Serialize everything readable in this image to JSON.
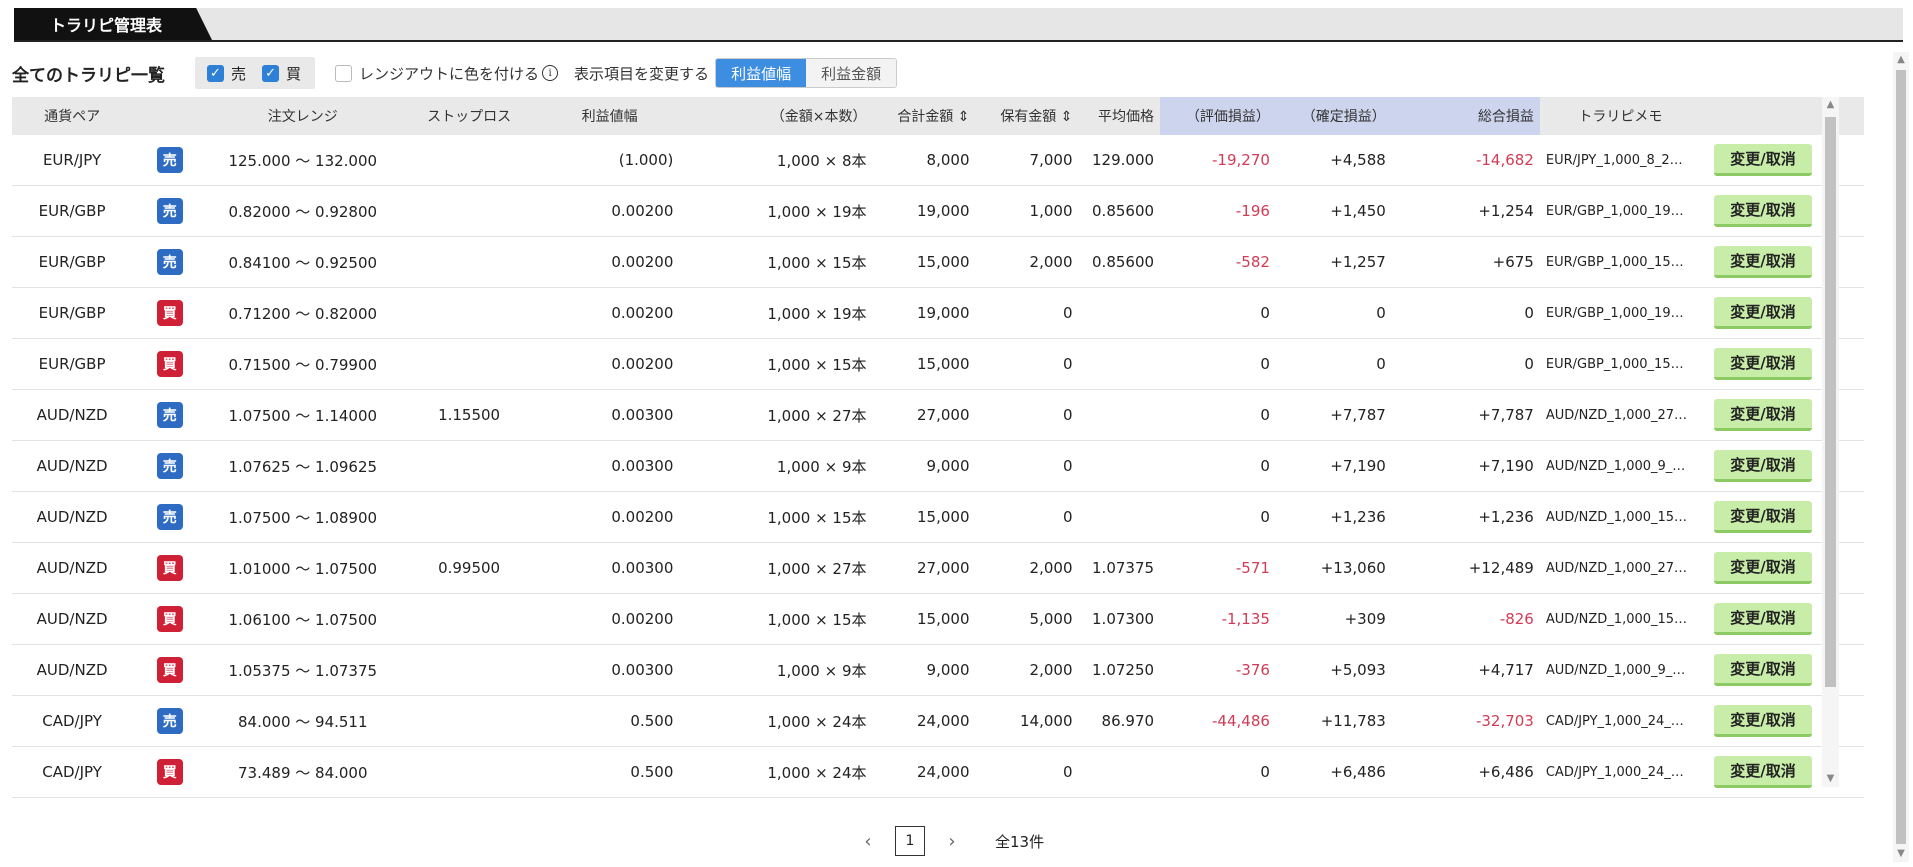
{
  "tabs": {
    "active_label": "トラリピ管理表"
  },
  "toolbar": {
    "title": "全てのトラリピ一覧",
    "sell_label": "売",
    "buy_label": "買",
    "color_label": "レンジアウトに色を付ける",
    "info_glyph": "i",
    "change_label": "表示項目を変更する",
    "seg_on": "利益値幅",
    "seg_off": "利益金額"
  },
  "table": {
    "headers": {
      "pair": "通貨ペア",
      "range": "注文レンジ",
      "stop": "ストップロス",
      "width": "利益値幅",
      "amount": "（金額×本数）",
      "total": "合計金額 ⇕",
      "holding": "保有金額 ⇕",
      "avg": "平均価格",
      "unreal": "（評価損益）",
      "realized": "（確定損益）",
      "sum": "総合損益",
      "memo": "トラリピメモ"
    },
    "edit_label": "変更/取消",
    "rows": [
      {
        "pair": "EUR/JPY",
        "side": "売",
        "range": "125.000 〜 132.000",
        "stop": "",
        "width": "(1.000)",
        "amount": "1,000 × 8本",
        "total": "8,000",
        "holding": "7,000",
        "avg": "129.000",
        "unreal": "-19,270",
        "realized": "+4,588",
        "sum": "-14,682",
        "memo": "EUR/JPY_1,000_8_2…"
      },
      {
        "pair": "EUR/GBP",
        "side": "売",
        "range": "0.82000 〜 0.92800",
        "stop": "",
        "width": "0.00200",
        "amount": "1,000 × 19本",
        "total": "19,000",
        "holding": "1,000",
        "avg": "0.85600",
        "unreal": "-196",
        "realized": "+1,450",
        "sum": "+1,254",
        "memo": "EUR/GBP_1,000_19…"
      },
      {
        "pair": "EUR/GBP",
        "side": "売",
        "range": "0.84100 〜 0.92500",
        "stop": "",
        "width": "0.00200",
        "amount": "1,000 × 15本",
        "total": "15,000",
        "holding": "2,000",
        "avg": "0.85600",
        "unreal": "-582",
        "realized": "+1,257",
        "sum": "+675",
        "memo": "EUR/GBP_1,000_15…"
      },
      {
        "pair": "EUR/GBP",
        "side": "買",
        "range": "0.71200 〜 0.82000",
        "stop": "",
        "width": "0.00200",
        "amount": "1,000 × 19本",
        "total": "19,000",
        "holding": "0",
        "avg": "",
        "unreal": "0",
        "realized": "0",
        "sum": "0",
        "memo": "EUR/GBP_1,000_19…"
      },
      {
        "pair": "EUR/GBP",
        "side": "買",
        "range": "0.71500 〜 0.79900",
        "stop": "",
        "width": "0.00200",
        "amount": "1,000 × 15本",
        "total": "15,000",
        "holding": "0",
        "avg": "",
        "unreal": "0",
        "realized": "0",
        "sum": "0",
        "memo": "EUR/GBP_1,000_15…"
      },
      {
        "pair": "AUD/NZD",
        "side": "売",
        "range": "1.07500 〜 1.14000",
        "stop": "1.15500",
        "width": "0.00300",
        "amount": "1,000 × 27本",
        "total": "27,000",
        "holding": "0",
        "avg": "",
        "unreal": "0",
        "realized": "+7,787",
        "sum": "+7,787",
        "memo": "AUD/NZD_1,000_27…"
      },
      {
        "pair": "AUD/NZD",
        "side": "売",
        "range": "1.07625 〜 1.09625",
        "stop": "",
        "width": "0.00300",
        "amount": "1,000 × 9本",
        "total": "9,000",
        "holding": "0",
        "avg": "",
        "unreal": "0",
        "realized": "+7,190",
        "sum": "+7,190",
        "memo": "AUD/NZD_1,000_9_…"
      },
      {
        "pair": "AUD/NZD",
        "side": "売",
        "range": "1.07500 〜 1.08900",
        "stop": "",
        "width": "0.00200",
        "amount": "1,000 × 15本",
        "total": "15,000",
        "holding": "0",
        "avg": "",
        "unreal": "0",
        "realized": "+1,236",
        "sum": "+1,236",
        "memo": "AUD/NZD_1,000_15…"
      },
      {
        "pair": "AUD/NZD",
        "side": "買",
        "range": "1.01000 〜 1.07500",
        "stop": "0.99500",
        "width": "0.00300",
        "amount": "1,000 × 27本",
        "total": "27,000",
        "holding": "2,000",
        "avg": "1.07375",
        "unreal": "-571",
        "realized": "+13,060",
        "sum": "+12,489",
        "memo": "AUD/NZD_1,000_27…"
      },
      {
        "pair": "AUD/NZD",
        "side": "買",
        "range": "1.06100 〜 1.07500",
        "stop": "",
        "width": "0.00200",
        "amount": "1,000 × 15本",
        "total": "15,000",
        "holding": "5,000",
        "avg": "1.07300",
        "unreal": "-1,135",
        "realized": "+309",
        "sum": "-826",
        "memo": "AUD/NZD_1,000_15…"
      },
      {
        "pair": "AUD/NZD",
        "side": "買",
        "range": "1.05375 〜 1.07375",
        "stop": "",
        "width": "0.00300",
        "amount": "1,000 × 9本",
        "total": "9,000",
        "holding": "2,000",
        "avg": "1.07250",
        "unreal": "-376",
        "realized": "+5,093",
        "sum": "+4,717",
        "memo": "AUD/NZD_1,000_9_…"
      },
      {
        "pair": "CAD/JPY",
        "side": "売",
        "range": "84.000 〜 94.511",
        "stop": "",
        "width": "0.500",
        "amount": "1,000 × 24本",
        "total": "24,000",
        "holding": "14,000",
        "avg": "86.970",
        "unreal": "-44,486",
        "realized": "+11,783",
        "sum": "-32,703",
        "memo": "CAD/JPY_1,000_24_…"
      },
      {
        "pair": "CAD/JPY",
        "side": "買",
        "range": "73.489 〜 84.000",
        "stop": "",
        "width": "0.500",
        "amount": "1,000 × 24本",
        "total": "24,000",
        "holding": "0",
        "avg": "",
        "unreal": "0",
        "realized": "+6,486",
        "sum": "+6,486",
        "memo": "CAD/JPY_1,000_24_…"
      }
    ]
  },
  "pagination": {
    "prev": "‹",
    "page": "1",
    "next": "›",
    "total": "全13件"
  },
  "colors": {
    "sell": "#2d6cc2",
    "buy": "#cf2035",
    "negative": "#d23b55",
    "accent": "#3d8ee0",
    "edit_button": "#c8eda8"
  }
}
